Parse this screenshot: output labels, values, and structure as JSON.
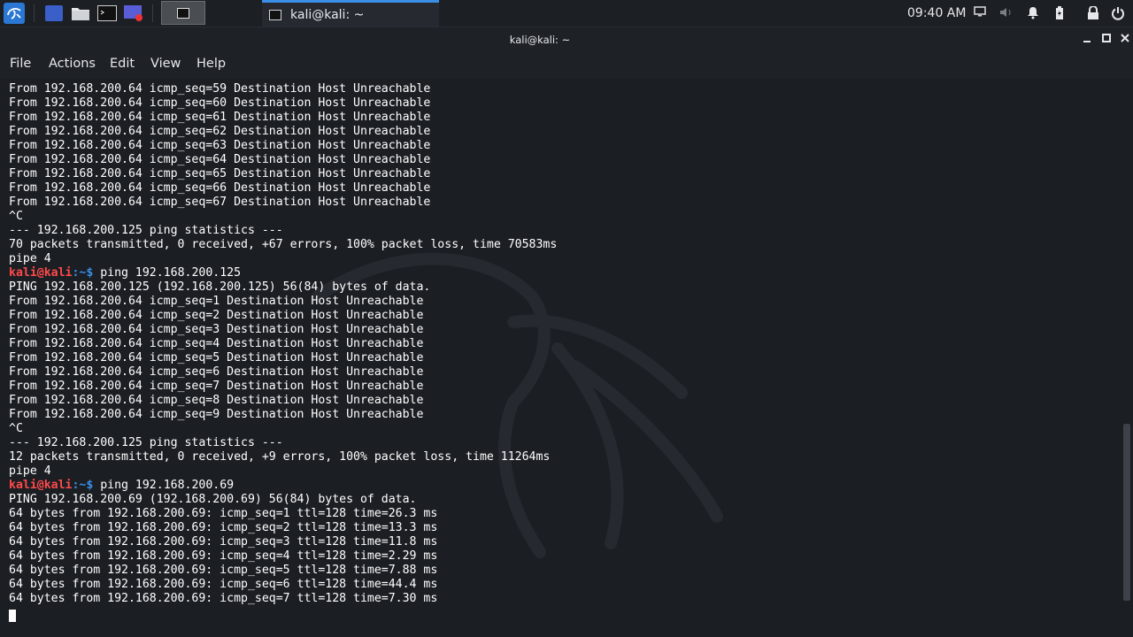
{
  "panel": {
    "clock": "09:40 AM",
    "taskbar": {
      "label": "kali@kali: ~"
    },
    "launchers": [
      "show-desktop-icon",
      "file-manager-icon",
      "terminal-icon",
      "screen-recorder-icon"
    ],
    "tray_icons": [
      "display-icon",
      "volume-icon",
      "notification-bell-icon",
      "battery-icon",
      "lock-icon",
      "power-icon"
    ]
  },
  "window": {
    "title": "kali@kali: ~"
  },
  "menu": {
    "items": [
      "File",
      "Actions",
      "Edit",
      "View",
      "Help"
    ]
  },
  "terminal": {
    "lines": [
      {
        "type": "out",
        "text": "From 192.168.200.64 icmp_seq=59 Destination Host Unreachable"
      },
      {
        "type": "out",
        "text": "From 192.168.200.64 icmp_seq=60 Destination Host Unreachable"
      },
      {
        "type": "out",
        "text": "From 192.168.200.64 icmp_seq=61 Destination Host Unreachable"
      },
      {
        "type": "out",
        "text": "From 192.168.200.64 icmp_seq=62 Destination Host Unreachable"
      },
      {
        "type": "out",
        "text": "From 192.168.200.64 icmp_seq=63 Destination Host Unreachable"
      },
      {
        "type": "out",
        "text": "From 192.168.200.64 icmp_seq=64 Destination Host Unreachable"
      },
      {
        "type": "out",
        "text": "From 192.168.200.64 icmp_seq=65 Destination Host Unreachable"
      },
      {
        "type": "out",
        "text": "From 192.168.200.64 icmp_seq=66 Destination Host Unreachable"
      },
      {
        "type": "out",
        "text": "From 192.168.200.64 icmp_seq=67 Destination Host Unreachable"
      },
      {
        "type": "out",
        "text": "^C"
      },
      {
        "type": "out",
        "text": "--- 192.168.200.125 ping statistics ---"
      },
      {
        "type": "out",
        "text": "70 packets transmitted, 0 received, +67 errors, 100% packet loss, time 70583ms"
      },
      {
        "type": "out",
        "text": "pipe 4"
      },
      {
        "type": "prompt",
        "user": "kali@kali",
        "path": ":~$ ",
        "cmd": "ping 192.168.200.125"
      },
      {
        "type": "out",
        "text": "PING 192.168.200.125 (192.168.200.125) 56(84) bytes of data."
      },
      {
        "type": "out",
        "text": "From 192.168.200.64 icmp_seq=1 Destination Host Unreachable"
      },
      {
        "type": "out",
        "text": "From 192.168.200.64 icmp_seq=2 Destination Host Unreachable"
      },
      {
        "type": "out",
        "text": "From 192.168.200.64 icmp_seq=3 Destination Host Unreachable"
      },
      {
        "type": "out",
        "text": "From 192.168.200.64 icmp_seq=4 Destination Host Unreachable"
      },
      {
        "type": "out",
        "text": "From 192.168.200.64 icmp_seq=5 Destination Host Unreachable"
      },
      {
        "type": "out",
        "text": "From 192.168.200.64 icmp_seq=6 Destination Host Unreachable"
      },
      {
        "type": "out",
        "text": "From 192.168.200.64 icmp_seq=7 Destination Host Unreachable"
      },
      {
        "type": "out",
        "text": "From 192.168.200.64 icmp_seq=8 Destination Host Unreachable"
      },
      {
        "type": "out",
        "text": "From 192.168.200.64 icmp_seq=9 Destination Host Unreachable"
      },
      {
        "type": "out",
        "text": "^C"
      },
      {
        "type": "out",
        "text": "--- 192.168.200.125 ping statistics ---"
      },
      {
        "type": "out",
        "text": "12 packets transmitted, 0 received, +9 errors, 100% packet loss, time 11264ms"
      },
      {
        "type": "out",
        "text": "pipe 4"
      },
      {
        "type": "prompt",
        "user": "kali@kali",
        "path": ":~$ ",
        "cmd": "ping 192.168.200.69"
      },
      {
        "type": "out",
        "text": "PING 192.168.200.69 (192.168.200.69) 56(84) bytes of data."
      },
      {
        "type": "out",
        "text": "64 bytes from 192.168.200.69: icmp_seq=1 ttl=128 time=26.3 ms"
      },
      {
        "type": "out",
        "text": "64 bytes from 192.168.200.69: icmp_seq=2 ttl=128 time=13.3 ms"
      },
      {
        "type": "out",
        "text": "64 bytes from 192.168.200.69: icmp_seq=3 ttl=128 time=11.8 ms"
      },
      {
        "type": "out",
        "text": "64 bytes from 192.168.200.69: icmp_seq=4 ttl=128 time=2.29 ms"
      },
      {
        "type": "out",
        "text": "64 bytes from 192.168.200.69: icmp_seq=5 ttl=128 time=7.88 ms"
      },
      {
        "type": "out",
        "text": "64 bytes from 192.168.200.69: icmp_seq=6 ttl=128 time=44.4 ms"
      },
      {
        "type": "out",
        "text": "64 bytes from 192.168.200.69: icmp_seq=7 ttl=128 time=7.30 ms"
      }
    ]
  },
  "colors": {
    "prompt_user": "#ff4a4a",
    "prompt_path": "#3a8ee6",
    "background": "#1b1e23"
  }
}
